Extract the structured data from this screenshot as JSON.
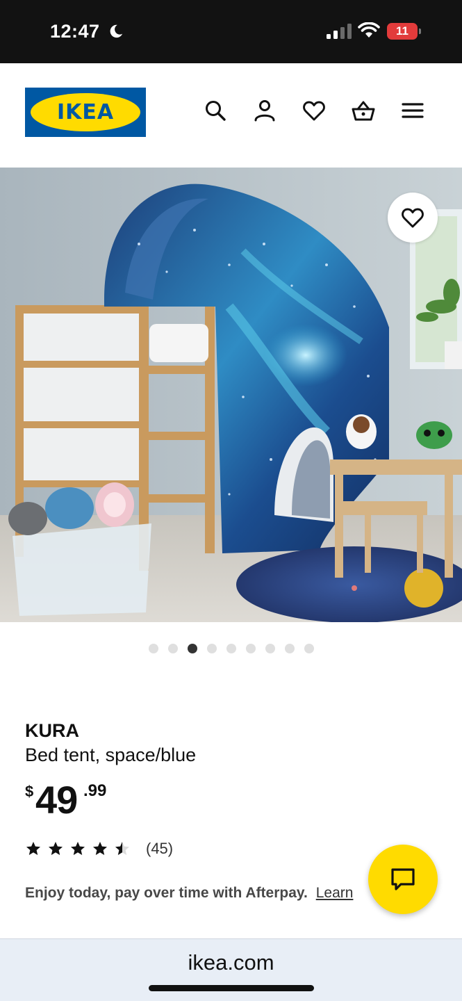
{
  "status_bar": {
    "time": "12:47",
    "battery": "11",
    "icons": [
      "moon-icon",
      "signal-icon",
      "wifi-icon",
      "battery-icon"
    ]
  },
  "header": {
    "logo_text": "IKEA",
    "icons": [
      "search-icon",
      "account-icon",
      "heart-icon",
      "basket-icon",
      "menu-icon"
    ],
    "colors": {
      "logo_blue": "#0058a3",
      "logo_yellow": "#ffdb00"
    }
  },
  "hero": {
    "image": "product-photo",
    "favorite_icon": "heart-icon",
    "carousel": {
      "total": 9,
      "active_index": 2
    }
  },
  "product": {
    "name": "KURA",
    "description": "Bed tent, space/blue",
    "price": {
      "currency": "$",
      "integer": "49",
      "decimal": ".99"
    },
    "rating": {
      "stars": 4.5,
      "max": 5,
      "count_label": "(45)"
    },
    "afterpay_text": "Enjoy today, pay over time with Afterpay.",
    "afterpay_link": "Learn"
  },
  "chat": {
    "icon": "chat-icon",
    "color": "#ffdb00"
  },
  "browser": {
    "url": "ikea.com"
  }
}
